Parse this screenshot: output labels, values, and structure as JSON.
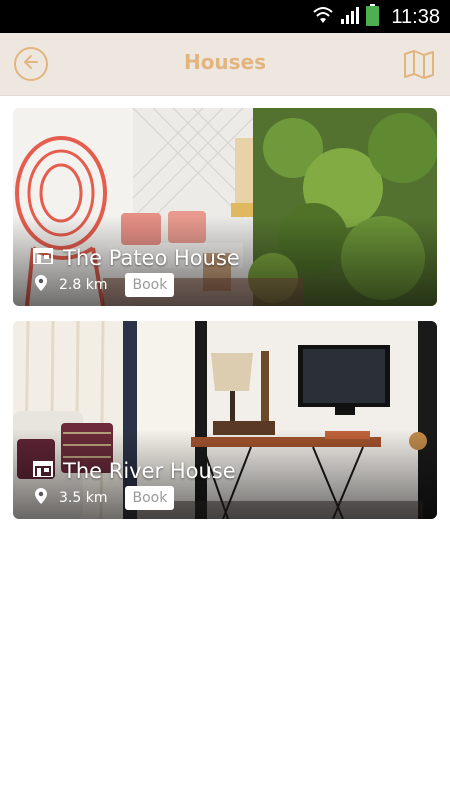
{
  "status_bar": {
    "time": "11:38"
  },
  "header": {
    "title": "Houses"
  },
  "houses": [
    {
      "name": "The Pateo House",
      "distance": "2.8 km",
      "book_label": "Book"
    },
    {
      "name": "The River House",
      "distance": "3.5 km",
      "book_label": "Book"
    }
  ],
  "colors": {
    "accent": "#e2b57f",
    "header_bg": "#ede7df"
  }
}
